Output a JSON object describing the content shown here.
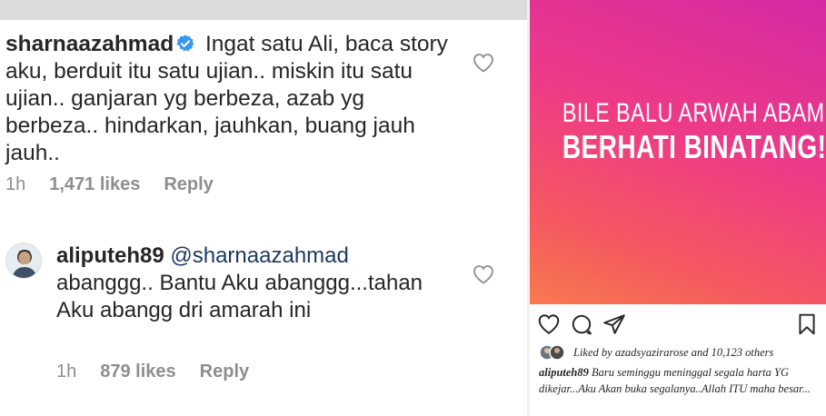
{
  "left": {
    "comment1": {
      "username": "sharnaazahmad",
      "text": "Ingat satu Ali, baca story aku, berduit itu satu ujian.. miskin itu satu ujian.. ganjaran yg berbeza, azab yg berbeza.. hindarkan, jauhkan, buang jauh jauh..",
      "time": "1h",
      "likes": "1,471 likes",
      "reply": "Reply"
    },
    "comment2": {
      "username": "aliputeh89",
      "mention": "@sharnaazahmad",
      "text": "abanggg.. Bantu Aku abanggg...tahan Aku abangg dri amarah ini",
      "time": "1h",
      "likes": "879 likes",
      "reply": "Reply"
    }
  },
  "right": {
    "story": {
      "line1": "BILE BALU ARWAH ABAM",
      "line2": "BERHATI BINATANG!!!"
    },
    "likes_text": "Liked by azadsyazirarose and 10,123 others",
    "caption": {
      "username": "aliputeh89",
      "text": "Baru seminggu meninggal segala harta YG dikejar...Aku Akan buka segalanya..Allah ITU maha besar..."
    }
  },
  "colors": {
    "text": "#262626",
    "meta": "#8e8e8e",
    "verified": "#3897f0",
    "gradient_top": "#d42aa3",
    "gradient_bottom": "#f87a4e"
  },
  "icons": [
    "verified-badge-icon",
    "heart-icon",
    "comment-icon",
    "share-icon",
    "bookmark-icon"
  ]
}
